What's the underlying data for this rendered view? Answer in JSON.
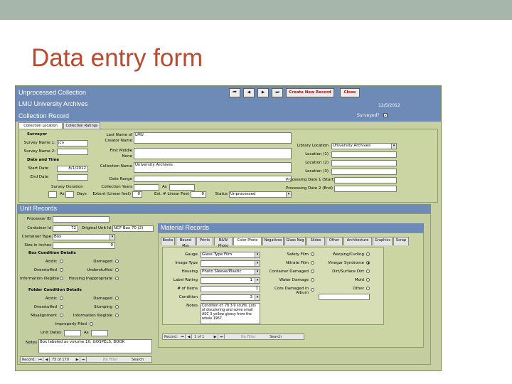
{
  "slide": {
    "title": "Data entry form"
  },
  "header": {
    "line1": "Unprocessed Collection",
    "line2": "LMU University Archives",
    "line3": "Collection Record",
    "date": "12/5/2012",
    "create_label": "Create New Record",
    "close_label": "Close",
    "nav_first": "⏮",
    "nav_prev": "◀",
    "nav_next": "▶",
    "nav_last": "⏭",
    "surveyed_label": "Surveyed?",
    "surveyed_mark": "✓"
  },
  "collection_tabs": [
    {
      "label": "Collection Location"
    },
    {
      "label": "Collection Ratings"
    }
  ],
  "surveyor": {
    "heading": "Surveyor",
    "name1_label": "Survey Name 1:",
    "name1_value": "jcn",
    "name2_label": "Survey Name 2:",
    "name2_value": "",
    "dt_heading": "Date and Time",
    "start_label": "Start Date",
    "start_value": "8/1/2012",
    "end_label": "End Date",
    "end_value": "",
    "duration_label": "Survey Duration",
    "as_label": "As",
    "days_label": "Days"
  },
  "collection": {
    "last_name_label": "Last Name of",
    "last_name_value": "LMU",
    "creator_label": "Creator Name",
    "first_middle_label": "First Middle",
    "first_middle_value": "None",
    "name_label": "Collection Name",
    "name_value": "University Archives",
    "dates_label": "Date Range",
    "coll_years_label": "Collection Years",
    "as2_label": "As",
    "extent_label": "Extent (Linear feet)",
    "extent_value": "0",
    "extent_ft_label": "Est. # Linear Feet",
    "extent_ft_value": "0",
    "status_label": "Status",
    "status_value": "Unprocessed"
  },
  "location": {
    "library_label": "Library Location",
    "library_value": "University Archives",
    "loc1_label": "Location (1)",
    "loc2_label": "Location (2)",
    "loc3_label": "Location (3)",
    "proc1_label": "Processing Date 1 (Start)",
    "proc2_label": "Processing Date 2 (End)"
  },
  "unit": {
    "heading": "Unit Records",
    "processor_label": "Processor ID",
    "processor_value": "",
    "unit_id_label": "Container Id",
    "unit_id_value": "72",
    "orig_label": "Original Unit Id",
    "orig_value": "NCF Box 70 (2)",
    "type_label": "Container Type",
    "type_value": "Box",
    "size_label": "Size in inches",
    "size_value": "0",
    "bcd_heading": "Box Condition Details",
    "acidic_label": "Acidic",
    "damaged_label": "Damaged",
    "overstuffed_label": "Overstuffed",
    "understuffed_label": "Understuffed",
    "info_label": "Information Illegible",
    "improper_label": "Housing Inappropriate",
    "fcd_heading": "Folder Condition Details",
    "acidic2_label": "Acidic",
    "damaged2_label": "Damaged",
    "overstuffed2_label": "Overstuffed",
    "slumping_label": "Slumping",
    "misalign_label": "Misalignment",
    "info2_label": "Information Illegible",
    "improper2_label": "Improperly Filed",
    "unit_dates_label": "Unit Dates",
    "unit_as_label": "As",
    "notes_label": "Notes",
    "notes_value": "Box labeled as volume 10, GOSPELS, BOOK",
    "record_label": "Record:",
    "record_value": "75 of 170",
    "nofilter_label": "No Filter",
    "search_label": "Search"
  },
  "material": {
    "heading": "Material Records",
    "tabs": [
      {
        "label": "Books"
      },
      {
        "label": "Bound Mss"
      },
      {
        "label": "Prints"
      },
      {
        "label": "B&W Photo"
      },
      {
        "label": "Color Photo"
      },
      {
        "label": "Negatives"
      },
      {
        "label": "Glass Neg"
      },
      {
        "label": "Slides"
      },
      {
        "label": "Other"
      },
      {
        "label": "Architecture"
      },
      {
        "label": "Graphics"
      },
      {
        "label": "Scrap"
      }
    ],
    "gauge_label": "Gauge",
    "gauge_value": "Glass Type Film",
    "image_label": "Image Type",
    "image_value": "",
    "housing_label": "Housing",
    "housing_value": "Photo Sleeve/Plastic",
    "rating_label": "Label Rating",
    "rating_value": "1",
    "items_label": "# of Items",
    "items_value": "1",
    "condition_label": "Condition",
    "condition_value": "3",
    "notes_label": "Notes",
    "notes_value": "Condition of: 78 3-9 scuffs. Lots of discoloring and some small ASC 3 yellow glossy from the whole 1967.",
    "safety_label": "Safety Film",
    "nitrate_label": "Nitrate Film",
    "container_dmg_label": "Container Damaged",
    "water_dmg_label": "Water Damage",
    "core_dmg_label": "Core Damaged in Album",
    "warping_label": "Warping/Curling",
    "vinegar_label": "Vinegar Syndrome",
    "dirt_label": "Dirt/Surface Dirt",
    "mold_label": "Mold",
    "other_label": "Other",
    "record_label": "Record:",
    "record_value": "1 of 1",
    "nofilter_label": "No Filter",
    "search_label": "Search"
  }
}
